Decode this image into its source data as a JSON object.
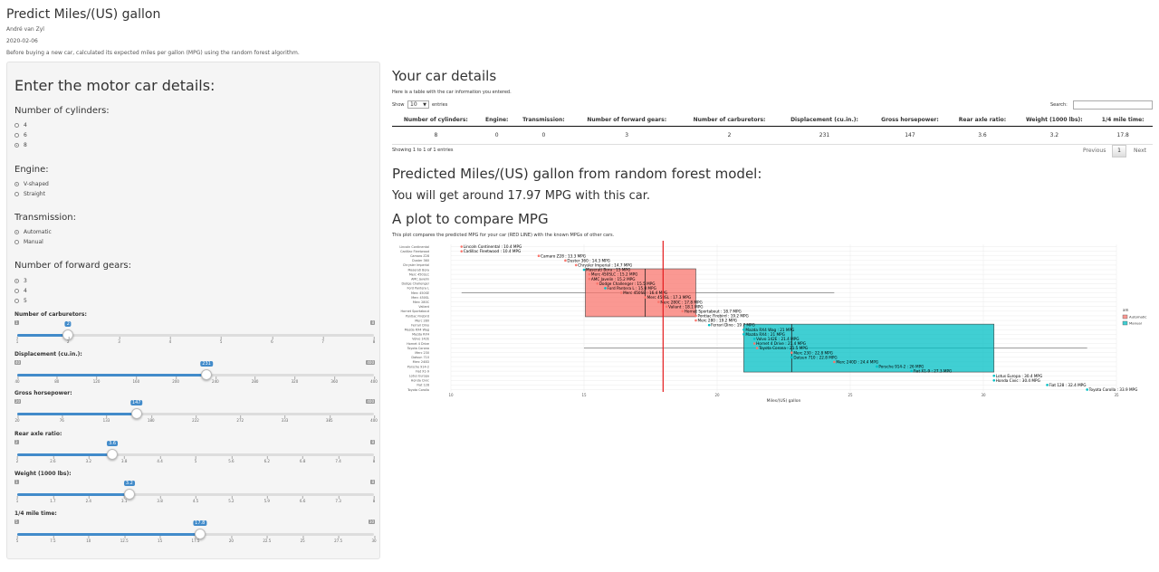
{
  "app": {
    "title": "Predict Miles/(US) gallon",
    "author": "André van Zyl",
    "date": "2020-02-06",
    "description": "Before buying a new car, calculated its expected miles per gallon (MPG) using the random forest algorithm."
  },
  "sidebar": {
    "heading": "Enter the motor car details:",
    "cylinders": {
      "label": "Number of cylinders:",
      "options": [
        "4",
        "6",
        "8"
      ],
      "selected": "8"
    },
    "engine": {
      "label": "Engine:",
      "options": [
        "V-shaped",
        "Straight"
      ],
      "selected": "V-shaped"
    },
    "transmission": {
      "label": "Transmission:",
      "options": [
        "Automatic",
        "Manual"
      ],
      "selected": "Automatic"
    },
    "gears": {
      "label": "Number of forward gears:",
      "options": [
        "3",
        "4",
        "5"
      ],
      "selected": "3"
    },
    "sliders": [
      {
        "label": "Number of carburetors:",
        "min": "1",
        "max": "8",
        "value": "2",
        "ticks": [
          "1",
          "2",
          "3",
          "4",
          "5",
          "6",
          "7",
          "8"
        ]
      },
      {
        "label": "Displacement (cu.in.):",
        "min": "40",
        "max": "400",
        "value": "231",
        "ticks": [
          "40",
          "80",
          "120",
          "160",
          "200",
          "240",
          "280",
          "320",
          "360",
          "400"
        ]
      },
      {
        "label": "Gross horsepower:",
        "min": "20",
        "max": "400",
        "value": "147",
        "ticks": [
          "20",
          "76",
          "133",
          "180",
          "222",
          "272",
          "333",
          "385",
          "400"
        ]
      },
      {
        "label": "Rear axle ratio:",
        "min": "2",
        "max": "8",
        "value": "3.6",
        "ticks": [
          "2",
          "2.6",
          "3.2",
          "3.8",
          "4.4",
          "5",
          "5.6",
          "6.2",
          "6.8",
          "7.4",
          "8"
        ]
      },
      {
        "label": "Weight (1000 lbs):",
        "min": "1",
        "max": "8",
        "value": "3.2",
        "ticks": [
          "1",
          "1.7",
          "2.4",
          "3.1",
          "3.8",
          "4.5",
          "5.2",
          "5.9",
          "6.6",
          "7.3",
          "8"
        ]
      },
      {
        "label": "1/4 mile time:",
        "min": "5",
        "max": "30",
        "value": "17.8",
        "ticks": [
          "5",
          "7.5",
          "10",
          "12.5",
          "15",
          "17.5",
          "20",
          "22.5",
          "25",
          "27.5",
          "30"
        ]
      }
    ]
  },
  "main": {
    "details_heading": "Your car details",
    "details_caption": "Here is a table with the car information you entered.",
    "show_label": "Show",
    "entries_value": "10",
    "entries_label": "entries",
    "search_label": "Search:",
    "table": {
      "headers": [
        "Number of cylinders:",
        "Engine:",
        "Transmission:",
        "Number of forward gears:",
        "Number of carburetors:",
        "Displacement (cu.in.):",
        "Gross horsepower:",
        "Rear axle ratio:",
        "Weight (1000 lbs):",
        "1/4 mile time:"
      ],
      "rows": [
        [
          "8",
          "0",
          "0",
          "3",
          "2",
          "231",
          "147",
          "3.6",
          "3.2",
          "17.8"
        ]
      ]
    },
    "showing": "Showing 1 to 1 of 1 entries",
    "previous": "Previous",
    "page": "1",
    "next": "Next",
    "predict_heading": "Predicted Miles/(US) gallon from random forest model:",
    "predict_text": "You will get around 17.97 MPG with this car.",
    "plot_heading": "A plot to compare MPG",
    "plot_caption": "This plot compares the predicted MPG for your car (RED LINE) with the known MPGs of other cars."
  },
  "chart_data": {
    "type": "scatter",
    "xlabel": "Miles/(US) gallon",
    "xlim": [
      10,
      35
    ],
    "xticks": [
      "10",
      "15",
      "20",
      "25",
      "30",
      "35"
    ],
    "prediction": 17.97,
    "legend": {
      "title": "am",
      "items": [
        "Automatic",
        "Manual"
      ],
      "placement": "right"
    },
    "colors": {
      "Automatic": "#f8766d",
      "Manual": "#00bfc4",
      "prediction": "#e41a1c"
    },
    "boxes": [
      {
        "group": "Automatic",
        "q1": 15.05,
        "median": 17.3,
        "q3": 19.2,
        "whisker_low": 10.4,
        "whisker_high": 24.4
      },
      {
        "group": "Manual",
        "q1": 21.0,
        "median": 22.8,
        "q3": 30.4,
        "whisker_low": 15.0,
        "whisker_high": 33.9
      }
    ],
    "cars": [
      {
        "name": "Lincoln Continental",
        "mpg": 10.4,
        "am": "Automatic"
      },
      {
        "name": "Cadillac Fleetwood",
        "mpg": 10.4,
        "am": "Automatic"
      },
      {
        "name": "Camaro Z28",
        "mpg": 13.3,
        "am": "Automatic"
      },
      {
        "name": "Duster 360",
        "mpg": 14.3,
        "am": "Automatic"
      },
      {
        "name": "Chrysler Imperial",
        "mpg": 14.7,
        "am": "Automatic"
      },
      {
        "name": "Maserati Bora",
        "mpg": 15.0,
        "am": "Manual"
      },
      {
        "name": "Merc 450SLC",
        "mpg": 15.2,
        "am": "Automatic"
      },
      {
        "name": "AMC Javelin",
        "mpg": 15.2,
        "am": "Automatic"
      },
      {
        "name": "Dodge Challenger",
        "mpg": 15.5,
        "am": "Automatic"
      },
      {
        "name": "Ford Pantera L",
        "mpg": 15.8,
        "am": "Manual"
      },
      {
        "name": "Merc 450SE",
        "mpg": 16.4,
        "am": "Automatic"
      },
      {
        "name": "Merc 450SL",
        "mpg": 17.3,
        "am": "Automatic"
      },
      {
        "name": "Merc 280C",
        "mpg": 17.8,
        "am": "Automatic"
      },
      {
        "name": "Valiant",
        "mpg": 18.1,
        "am": "Automatic"
      },
      {
        "name": "Hornet Sportabout",
        "mpg": 18.7,
        "am": "Automatic"
      },
      {
        "name": "Pontiac Firebird",
        "mpg": 19.2,
        "am": "Automatic"
      },
      {
        "name": "Merc 280",
        "mpg": 19.2,
        "am": "Automatic"
      },
      {
        "name": "Ferrari Dino",
        "mpg": 19.7,
        "am": "Manual"
      },
      {
        "name": "Mazda RX4 Wag",
        "mpg": 21.0,
        "am": "Manual"
      },
      {
        "name": "Mazda RX4",
        "mpg": 21.0,
        "am": "Manual"
      },
      {
        "name": "Volvo 142E",
        "mpg": 21.4,
        "am": "Manual"
      },
      {
        "name": "Hornet 4 Drive",
        "mpg": 21.4,
        "am": "Automatic"
      },
      {
        "name": "Toyota Corona",
        "mpg": 21.5,
        "am": "Automatic"
      },
      {
        "name": "Merc 230",
        "mpg": 22.8,
        "am": "Automatic"
      },
      {
        "name": "Datsun 710",
        "mpg": 22.8,
        "am": "Manual"
      },
      {
        "name": "Merc 240D",
        "mpg": 24.4,
        "am": "Automatic"
      },
      {
        "name": "Porsche 914-2",
        "mpg": 26.0,
        "am": "Manual"
      },
      {
        "name": "Fiat X1-9",
        "mpg": 27.3,
        "am": "Manual"
      },
      {
        "name": "Lotus Europa",
        "mpg": 30.4,
        "am": "Manual"
      },
      {
        "name": "Honda Civic",
        "mpg": 30.4,
        "am": "Manual"
      },
      {
        "name": "Fiat 128",
        "mpg": 32.4,
        "am": "Manual"
      },
      {
        "name": "Toyota Corolla",
        "mpg": 33.9,
        "am": "Manual"
      }
    ]
  }
}
